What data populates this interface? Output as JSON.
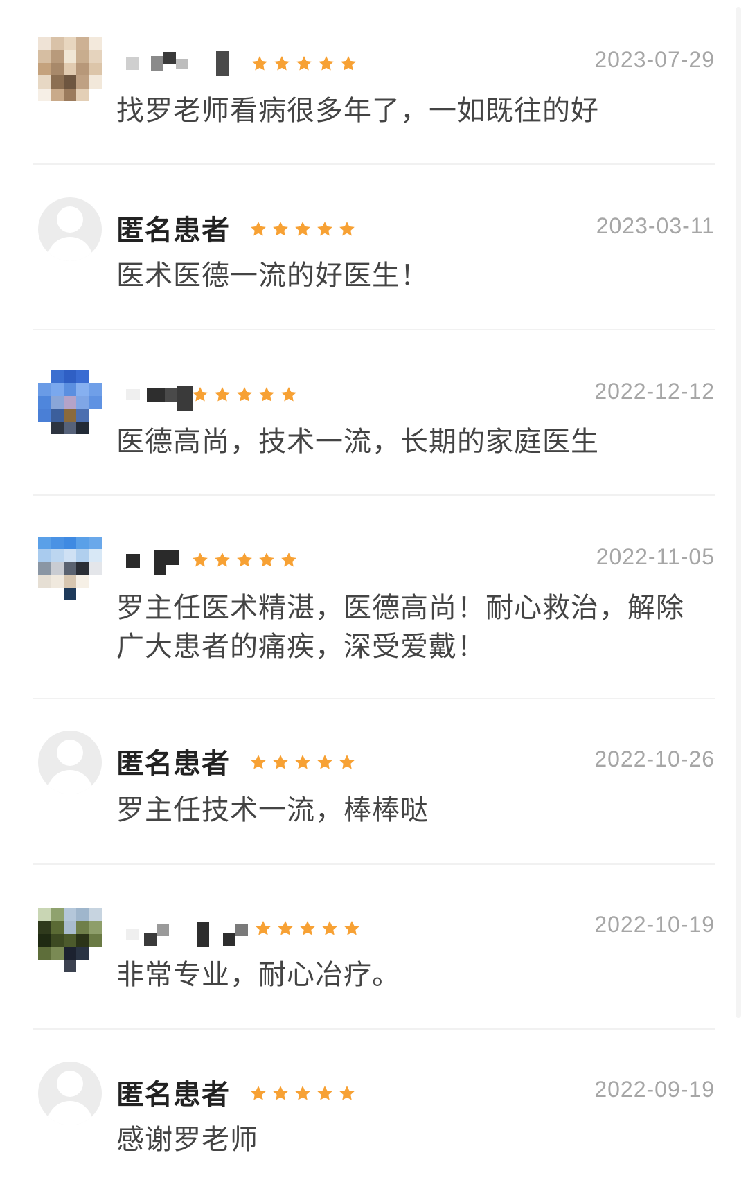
{
  "reviews": [
    {
      "name": "",
      "anonymous": false,
      "rating": 5,
      "date": "2023-07-29",
      "text": "找罗老师看病很多年了，一如既往的好"
    },
    {
      "name": "匿名患者",
      "anonymous": true,
      "rating": 5,
      "date": "2023-03-11",
      "text": "医术医德一流的好医生！"
    },
    {
      "name": "",
      "anonymous": false,
      "rating": 5,
      "date": "2022-12-12",
      "text": "医德高尚，技术一流，长期的家庭医生"
    },
    {
      "name": "",
      "anonymous": false,
      "rating": 5,
      "date": "2022-11-05",
      "text": "罗主任医术精湛，医德高尚！耐心救治，解除广大患者的痛疾，深受爱戴！"
    },
    {
      "name": "匿名患者",
      "anonymous": true,
      "rating": 5,
      "date": "2022-10-26",
      "text": "罗主任技术一流，棒棒哒"
    },
    {
      "name": "",
      "anonymous": false,
      "rating": 5,
      "date": "2022-10-19",
      "text": "非常专业，耐心冶疗。"
    },
    {
      "name": "匿名患者",
      "anonymous": true,
      "rating": 5,
      "date": "2022-09-19",
      "text": "感谢罗老师"
    }
  ],
  "colors": {
    "star": "#f7a134",
    "date": "#a6a6a6",
    "divider": "#f1f1f1"
  },
  "icons": {
    "star": "star-icon",
    "anonymous_avatar": "default-avatar-icon"
  }
}
